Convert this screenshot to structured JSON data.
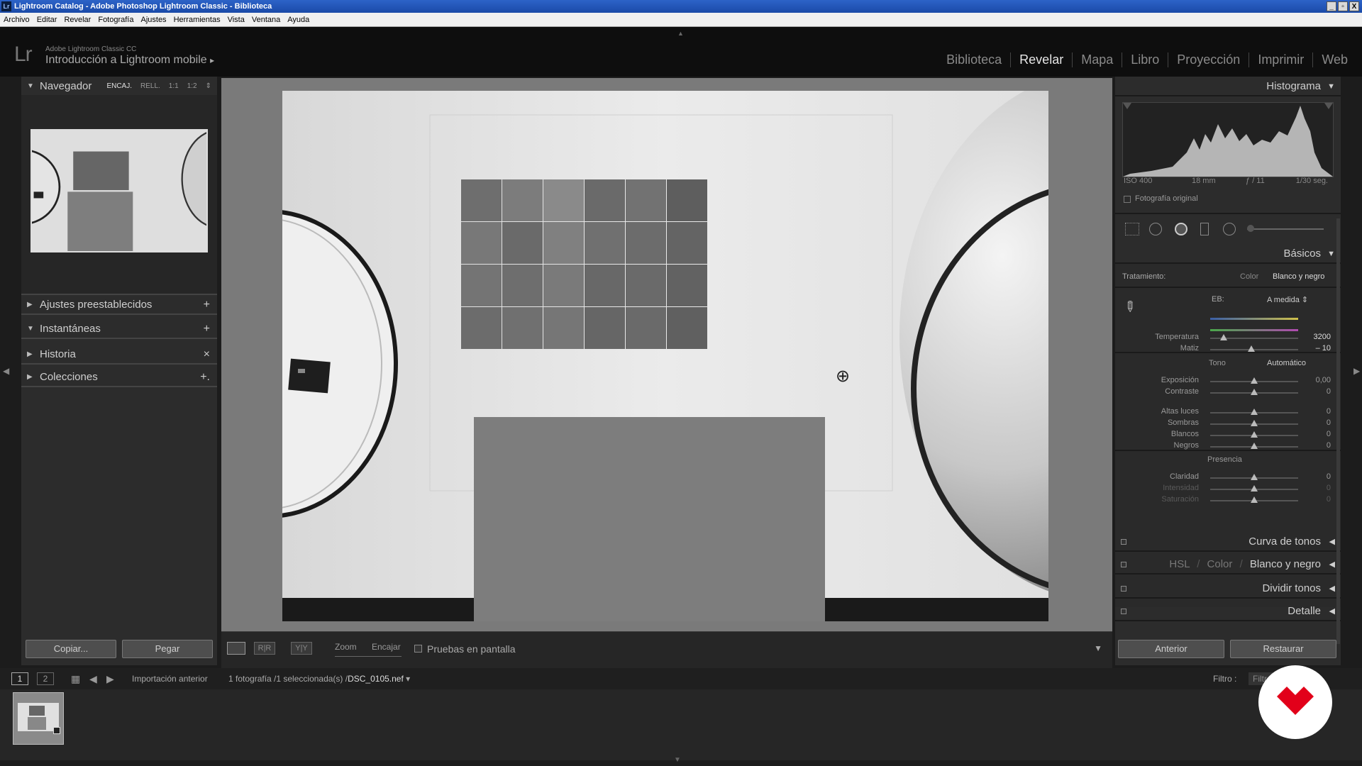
{
  "window": {
    "title": "Lightroom Catalog - Adobe Photoshop Lightroom Classic - Biblioteca",
    "badge": "Lr",
    "controls": [
      "_",
      "▫",
      "X"
    ]
  },
  "menu": [
    "Archivo",
    "Editar",
    "Revelar",
    "Fotografía",
    "Ajustes",
    "Herramientas",
    "Vista",
    "Ventana",
    "Ayuda"
  ],
  "identity": {
    "logo": "Lr",
    "product": "Adobe Lightroom Classic CC",
    "task": "Introducción a Lightroom mobile",
    "task_arrow": "▸"
  },
  "modules": {
    "items": [
      "Biblioteca",
      "Revelar",
      "Mapa",
      "Libro",
      "Proyección",
      "Imprimir",
      "Web"
    ],
    "active": "Revelar"
  },
  "left": {
    "navigator": {
      "title": "Navegador",
      "options": [
        "ENCAJ.",
        "RELL.",
        "1:1",
        "1:2"
      ],
      "active_option": "ENCAJ."
    },
    "panels": [
      {
        "title": "Ajustes preestablecidos",
        "action": "+"
      },
      {
        "title": "Instantáneas",
        "action": "+"
      },
      {
        "title": "Historia",
        "action": "×"
      },
      {
        "title": "Colecciones",
        "action": "+."
      }
    ],
    "buttons": {
      "copy": "Copiar...",
      "paste": "Pegar"
    }
  },
  "toolbar": {
    "zoom_label": "Zoom",
    "zoom_value": "Encajar",
    "softproof_label": "Pruebas en pantalla",
    "view_labels": [
      "R|R",
      "Y|Y"
    ]
  },
  "right": {
    "histogram": {
      "title": "Histograma",
      "iso": "ISO 400",
      "focal": "18 mm",
      "aperture": "ƒ / 11",
      "shutter": "1/30 seg.",
      "original_label": "Fotografía original"
    },
    "basic": {
      "title": "Básicos",
      "treatment_label": "Tratamiento:",
      "treatment_color": "Color",
      "treatment_bw": "Blanco y negro",
      "wb_label": "EB:",
      "wb_value": "A medida",
      "tone_label": "Tono",
      "auto_label": "Automático",
      "presence_label": "Presencia",
      "sliders": [
        {
          "label": "Temperatura",
          "value": "3200",
          "pos": 0.15,
          "dim": false
        },
        {
          "label": "Matiz",
          "value": "– 10",
          "pos": 0.47,
          "dim": false
        },
        {
          "label": "Exposición",
          "value": "0,00",
          "pos": 0.5,
          "dim": false
        },
        {
          "label": "Contraste",
          "value": "0",
          "pos": 0.5,
          "dim": false
        },
        {
          "label": "Altas luces",
          "value": "0",
          "pos": 0.5,
          "dim": false
        },
        {
          "label": "Sombras",
          "value": "0",
          "pos": 0.5,
          "dim": false
        },
        {
          "label": "Blancos",
          "value": "0",
          "pos": 0.5,
          "dim": false
        },
        {
          "label": "Negros",
          "value": "0",
          "pos": 0.5,
          "dim": false
        },
        {
          "label": "Claridad",
          "value": "0",
          "pos": 0.5,
          "dim": false
        },
        {
          "label": "Intensidad",
          "value": "0",
          "pos": 0.5,
          "dim": true
        },
        {
          "label": "Saturación",
          "value": "0",
          "pos": 0.5,
          "dim": true
        }
      ]
    },
    "collapsed_panels": [
      {
        "title": "Curva de tonos"
      },
      {
        "title": "Dividir tonos"
      },
      {
        "title": "Detalle"
      }
    ],
    "hsl": {
      "hsl": "HSL",
      "sep": "/",
      "color": "Color",
      "bw": "Blanco y negro"
    },
    "buttons": {
      "previous": "Anterior",
      "reset": "Restaurar"
    }
  },
  "filmstrip": {
    "screen1": "1",
    "screen2": "2",
    "source": "Importación anterior",
    "info_prefix": "1 fotografía /1 seleccionada(s) /",
    "filename": "DSC_0105.nef",
    "filter_label": "Filtro :",
    "filter_value": "Filtro"
  },
  "colors": {
    "accent": "#e0e0e0",
    "panel": "#2c2c2c",
    "logo_red": "#e2001a"
  }
}
